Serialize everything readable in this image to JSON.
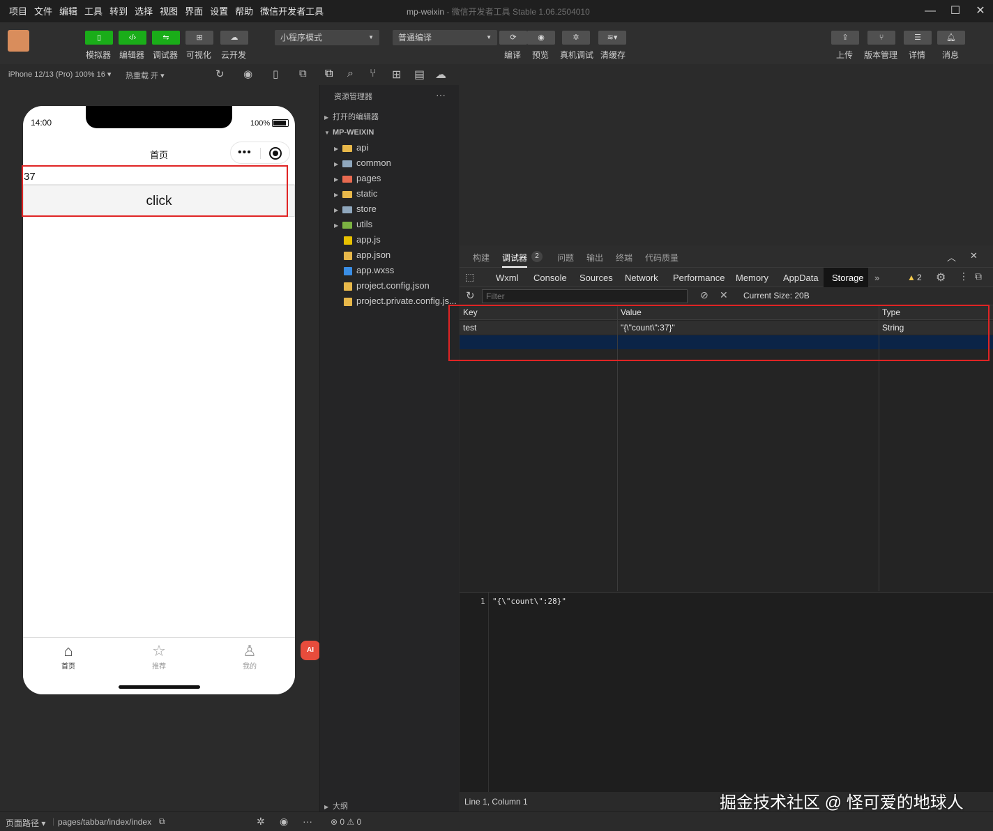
{
  "menu": [
    "项目",
    "文件",
    "编辑",
    "工具",
    "转到",
    "选择",
    "视图",
    "界面",
    "设置",
    "帮助",
    "微信开发者工具"
  ],
  "window": {
    "title": "mp-weixin",
    "subtitle": " - 微信开发者工具 Stable 1.06.2504010"
  },
  "toolbar": {
    "buttons": [
      "模拟器",
      "编辑器",
      "调试器",
      "可视化",
      "云开发"
    ],
    "mode_select": "小程序模式",
    "compile_select": "普通编译",
    "actions": [
      "编译",
      "预览",
      "真机调试",
      "清缓存"
    ],
    "right_actions": [
      "上传",
      "版本管理",
      "详情",
      "消息"
    ]
  },
  "simulator": {
    "device": "iPhone 12/13 (Pro) 100% 16 ▾",
    "hot_reload": "热重载 开 ▾",
    "time": "14:00",
    "battery": "100%",
    "nav_title": "首页",
    "input_value": "37",
    "button_label": "click",
    "tabs": [
      {
        "icon": "home-icon",
        "label": "首页"
      },
      {
        "icon": "star-icon",
        "label": "推荐"
      },
      {
        "icon": "user-icon",
        "label": "我的"
      }
    ],
    "ai_label": "AI"
  },
  "explorer": {
    "title": "资源管理器",
    "open_editors": "打开的编辑器",
    "project": "MP-WEIXIN",
    "items": [
      {
        "name": "api",
        "kind": "folder",
        "color": "#e8b84a"
      },
      {
        "name": "common",
        "kind": "folder",
        "color": "#8fa7bd"
      },
      {
        "name": "pages",
        "kind": "folder",
        "color": "#e86a50"
      },
      {
        "name": "static",
        "kind": "folder",
        "color": "#e8b84a"
      },
      {
        "name": "store",
        "kind": "folder",
        "color": "#8fa7bd"
      },
      {
        "name": "utils",
        "kind": "folder",
        "color": "#7cb342"
      },
      {
        "name": "app.js",
        "kind": "file",
        "color": "#e8c100"
      },
      {
        "name": "app.json",
        "kind": "file",
        "color": "#e8b84a"
      },
      {
        "name": "app.wxss",
        "kind": "file",
        "color": "#3a8ee6"
      },
      {
        "name": "project.config.json",
        "kind": "file",
        "color": "#e8b84a"
      },
      {
        "name": "project.private.config.js...",
        "kind": "file",
        "color": "#e8b84a"
      }
    ],
    "outline": "大纲",
    "problems": "⊗ 0 ⚠ 0"
  },
  "devtools": {
    "top_tabs": [
      "构建",
      "调试器",
      "问题",
      "输出",
      "终端",
      "代码质量"
    ],
    "debugger_badge": "2",
    "tabs": [
      "Wxml",
      "Console",
      "Sources",
      "Network",
      "Performance",
      "Memory",
      "AppData",
      "Storage"
    ],
    "more": "»",
    "warnings": "2",
    "filter_placeholder": "Filter",
    "current_size": "Current Size: 20B",
    "columns": [
      "Key",
      "Value",
      "Type"
    ],
    "rows": [
      {
        "key": "test",
        "value": "\"{\\\"count\\\":37}\"",
        "type": "String"
      }
    ],
    "editor_line_no": "1",
    "editor_text": "\"{\\\"count\\\":28}\"",
    "status": "Line 1, Column 1"
  },
  "statusbar": {
    "page_path_label": "页面路径 ▾",
    "page_path": "pages/tabbar/index/index"
  },
  "watermark": "掘金技术社区 @ 怪可爱的地球人",
  "colors": {
    "accent_green": "#1aad19",
    "highlight_red": "#e02424",
    "selected_row": "#0b2447"
  }
}
